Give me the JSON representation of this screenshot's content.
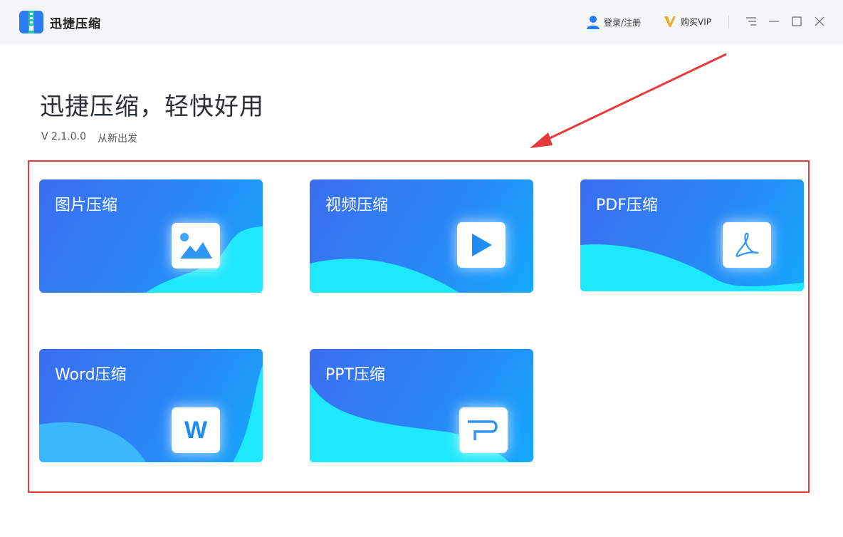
{
  "window": {
    "app_title": "迅捷压缩",
    "login_label": "登录/注册",
    "vip_label": "购买VIP"
  },
  "hero": {
    "headline": "迅捷压缩，轻快好用",
    "version": "V 2.1.0.0",
    "slogan": "从新出发"
  },
  "cards": [
    {
      "label": "图片压缩",
      "icon": "image-icon"
    },
    {
      "label": "视频压缩",
      "icon": "play-icon"
    },
    {
      "label": "PDF压缩",
      "icon": "pdf-icon"
    },
    {
      "label": "Word压缩",
      "icon": "word-icon",
      "icon_text": "W"
    },
    {
      "label": "PPT压缩",
      "icon": "ppt-icon"
    }
  ],
  "colors": {
    "card_start": "#3b6ef0",
    "card_end": "#14a9fd",
    "wave": "#1ee8fb",
    "highlight_frame": "#e63b3b",
    "vip_orange": "#f5a623"
  }
}
